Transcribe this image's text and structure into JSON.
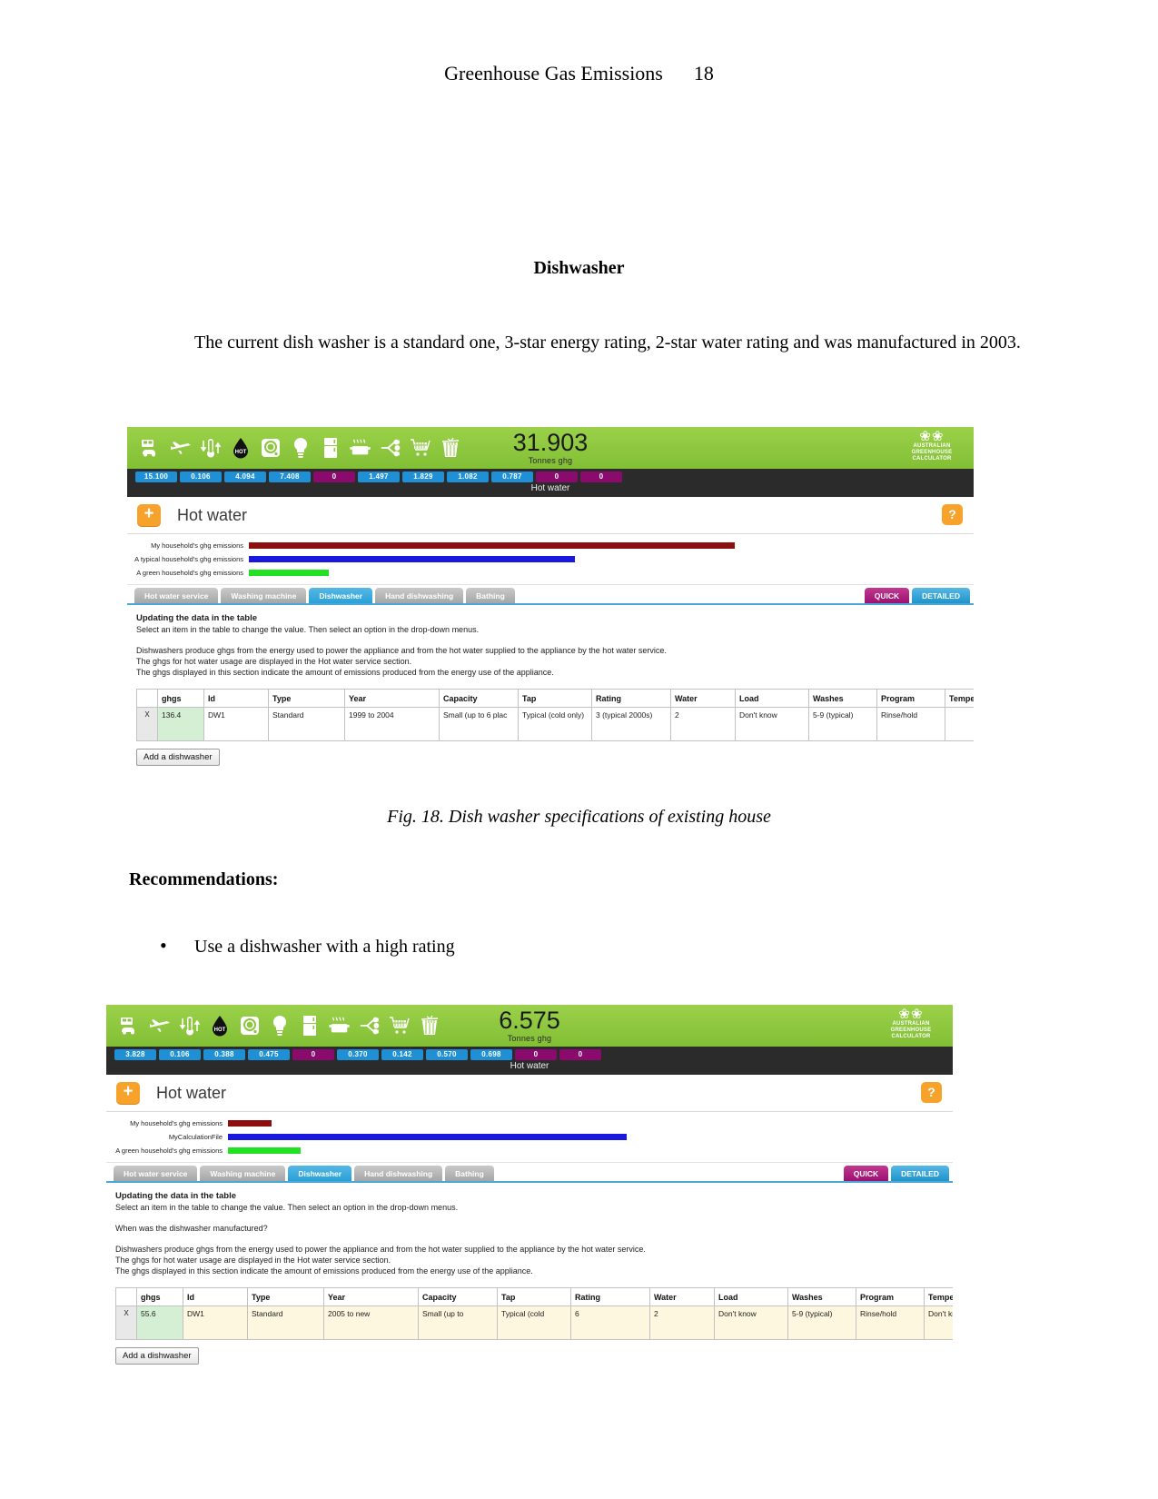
{
  "document": {
    "header_title": "Greenhouse Gas Emissions",
    "page_number": "18",
    "section_heading": "Dishwasher",
    "paragraph": "The current dish washer is a standard one, 3-star energy rating, 2-star water rating and was manufactured in 2003.",
    "figure_caption": "Fig. 18. Dish washer specifications of existing house",
    "recommendations_heading": "Recommendations:",
    "bullet_marker": "•",
    "bullet_text": "Use a dishwasher with a high rating"
  },
  "colors": {
    "green_bar": "#8cc63e",
    "badge_blue": "#1f8fd6",
    "badge_purple": "#8b0a6e",
    "orange": "#f7a32b",
    "tab_active": "#29a1d8",
    "tab_quick": "#9d1071",
    "bar_mine": "#8c0e0e",
    "bar_typical": "#1818e0",
    "bar_green": "#22e022",
    "ghg_cell": "#d4efd4"
  },
  "figure1": {
    "icons": [
      "car-icon",
      "airplane-icon",
      "thermometer-icon",
      "hot-water-drop-icon",
      "washing-machine-icon",
      "light-bulb-icon",
      "fridge-icon",
      "cooking-pot-icon",
      "power-plug-icon",
      "shopping-cart-icon",
      "waste-bin-icon"
    ],
    "badges": [
      {
        "value": "15.100",
        "color": "blue"
      },
      {
        "value": "0.106",
        "color": "blue"
      },
      {
        "value": "4.094",
        "color": "blue"
      },
      {
        "value": "7.408",
        "color": "blue"
      },
      {
        "value": "0",
        "color": "purple"
      },
      {
        "value": "1.497",
        "color": "blue"
      },
      {
        "value": "1.829",
        "color": "blue"
      },
      {
        "value": "1.082",
        "color": "blue"
      },
      {
        "value": "0.787",
        "color": "blue"
      },
      {
        "value": "0",
        "color": "purple"
      },
      {
        "value": "0",
        "color": "purple"
      }
    ],
    "total_value": "31.903",
    "total_unit": "Tonnes ghg",
    "logo_line1": "AUSTRALIAN",
    "logo_line2": "GREENHOUSE",
    "logo_line3": "CALCULATOR",
    "sub_caption": "Hot water",
    "plus_label": "+",
    "section_title": "Hot water",
    "help_label": "?",
    "chart_data": {
      "type": "bar",
      "title": "",
      "orientation": "horizontal",
      "categories": [
        "My household's ghg emissions",
        "A typical household's ghg emissions",
        "A green household's ghg emissions"
      ],
      "values": [
        67,
        45,
        11
      ],
      "unit": "percent of track width",
      "colors": [
        "#8c0e0e",
        "#1818e0",
        "#22e022"
      ],
      "xlabel": "",
      "ylabel": "",
      "grid": false,
      "legend": "none"
    },
    "tabs": [
      {
        "label": "Hot water service",
        "active": false
      },
      {
        "label": "Washing machine",
        "active": false
      },
      {
        "label": "Dishwasher",
        "active": true
      },
      {
        "label": "Hand dishwashing",
        "active": false
      },
      {
        "label": "Bathing",
        "active": false
      }
    ],
    "mode_tabs": [
      {
        "label": "QUICK",
        "kind": "quick"
      },
      {
        "label": "DETAILED",
        "kind": "detailed"
      }
    ],
    "update_heading": "Updating the data in the table",
    "update_text": "Select an item in the table to change the value. Then select an option in the drop-down menus.",
    "info_lines": [
      "Dishwashers produce ghgs from the energy used to power the appliance and from the hot water supplied to the appliance by the hot water service.",
      "The ghgs for hot water usage are displayed in the Hot water service section.",
      "The ghgs displayed in this section indicate the amount of emissions produced from the energy use of the appliance."
    ],
    "table": {
      "columns": [
        "",
        "ghgs",
        "Id",
        "Type",
        "Year",
        "Capacity",
        "Tap",
        "Rating",
        "Water",
        "Load",
        "Washes",
        "Program",
        "Temperature"
      ],
      "rows": [
        [
          "X",
          "136.4",
          "DW1",
          "Standard",
          "1999 to 2004",
          "Small (up to 6 plac",
          "Typical (cold only)",
          "3 (typical 2000s)",
          "2",
          "Don't know",
          "5-9 (typical)",
          "Rinse/hold",
          ""
        ]
      ]
    },
    "add_button": "Add a dishwasher"
  },
  "figure2": {
    "icons": [
      "car-icon",
      "airplane-icon",
      "thermometer-icon",
      "hot-water-drop-icon",
      "washing-machine-icon",
      "light-bulb-icon",
      "fridge-icon",
      "cooking-pot-icon",
      "power-plug-icon",
      "shopping-cart-icon",
      "waste-bin-icon"
    ],
    "badges": [
      {
        "value": "3.828",
        "color": "blue"
      },
      {
        "value": "0.106",
        "color": "blue"
      },
      {
        "value": "0.388",
        "color": "blue"
      },
      {
        "value": "0.475",
        "color": "blue"
      },
      {
        "value": "0",
        "color": "purple"
      },
      {
        "value": "0.370",
        "color": "blue"
      },
      {
        "value": "0.142",
        "color": "blue"
      },
      {
        "value": "0.570",
        "color": "blue"
      },
      {
        "value": "0.698",
        "color": "blue"
      },
      {
        "value": "0",
        "color": "purple"
      },
      {
        "value": "0",
        "color": "purple"
      }
    ],
    "total_value": "6.575",
    "total_unit": "Tonnes ghg",
    "logo_line1": "AUSTRALIAN",
    "logo_line2": "GREENHOUSE",
    "logo_line3": "CALCULATOR",
    "sub_caption": "Hot water",
    "plus_label": "+",
    "section_title": "Hot water",
    "help_label": "?",
    "chart_data": {
      "type": "bar",
      "title": "",
      "orientation": "horizontal",
      "categories": [
        "My household's ghg emissions",
        "MyCalculationFile",
        "A green household's ghg emissions"
      ],
      "values": [
        6,
        55,
        10
      ],
      "unit": "percent of track width",
      "colors": [
        "#8c0e0e",
        "#1818e0",
        "#22e022"
      ],
      "xlabel": "",
      "ylabel": "",
      "grid": false,
      "legend": "none"
    },
    "tabs": [
      {
        "label": "Hot water service",
        "active": false
      },
      {
        "label": "Washing machine",
        "active": false
      },
      {
        "label": "Dishwasher",
        "active": true
      },
      {
        "label": "Hand dishwashing",
        "active": false
      },
      {
        "label": "Bathing",
        "active": false
      }
    ],
    "mode_tabs": [
      {
        "label": "QUICK",
        "kind": "quick"
      },
      {
        "label": "DETAILED",
        "kind": "detailed"
      }
    ],
    "update_heading": "Updating the data in the table",
    "update_text": "Select an item in the table to change the value. Then select an option in the drop-down menus.",
    "question_text": "When was the dishwasher manufactured?",
    "info_lines": [
      "Dishwashers produce ghgs from the energy used to power the appliance and from the hot water supplied to the appliance by the hot water service.",
      "The ghgs for hot water usage are displayed in the Hot water service section.",
      "The ghgs displayed in this section indicate the amount of emissions produced from the energy use of the appliance."
    ],
    "table": {
      "columns": [
        "",
        "ghgs",
        "Id",
        "Type",
        "Year",
        "Capacity",
        "Tap",
        "Rating",
        "Water",
        "Load",
        "Washes",
        "Program",
        "Temperat..."
      ],
      "rows": [
        [
          "X",
          "55.6",
          "DW1",
          "Standard",
          "2005 to new",
          "Small (up to",
          "Typical (cold",
          "6",
          "2",
          "Don't know",
          "5-9 (typical)",
          "Rinse/hold",
          "Don't know"
        ]
      ]
    },
    "add_button": "Add a dishwasher"
  }
}
